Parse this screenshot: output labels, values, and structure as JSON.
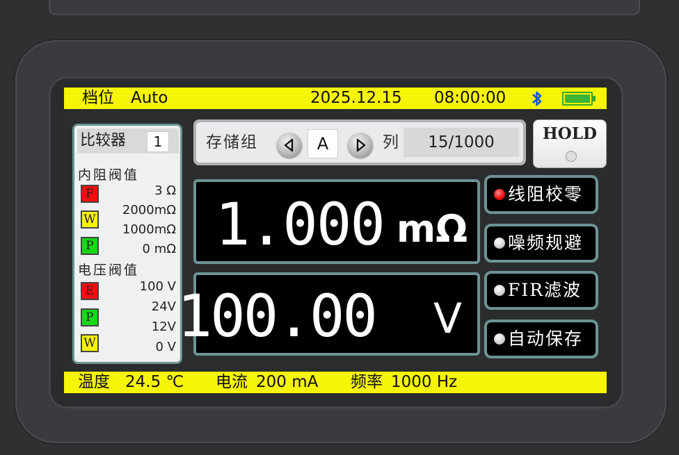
{
  "status": {
    "range_label": "档位",
    "range_value": "Auto",
    "date": "2025.12.15",
    "time": "08:00:00",
    "bluetooth_icon": "bluetooth-icon",
    "battery_icon": "battery-full-icon",
    "battery_level": 1.0
  },
  "comparator": {
    "label": "比较器",
    "value": "1"
  },
  "resistance_threshold": {
    "title": "内阻阀值",
    "levels": [
      {
        "badge": "F",
        "color": "#f20f0f",
        "value": "3 Ω"
      },
      {
        "badge": "W",
        "color": "#f6f407",
        "value": "2000mΩ"
      },
      {
        "badge": "P",
        "color": "#14d914",
        "value": "1000mΩ"
      },
      {
        "badge": "",
        "value": "0 mΩ"
      }
    ]
  },
  "voltage_threshold": {
    "title": "电压阀值",
    "levels": [
      {
        "badge": "E",
        "color": "#f20f0f",
        "value": "100 V"
      },
      {
        "badge": "P",
        "color": "#14d914",
        "value": "24V"
      },
      {
        "badge": "W",
        "color": "#f6f407",
        "value": "12V"
      },
      {
        "badge": "",
        "value": "0 V"
      }
    ]
  },
  "storage": {
    "label": "存储组",
    "group": "A",
    "column_label": "列",
    "count": "15/1000"
  },
  "hold": {
    "label": "HOLD"
  },
  "resistance": {
    "value": "1.000",
    "unit": "mΩ"
  },
  "voltage": {
    "value": "100.00",
    "unit": "V"
  },
  "functions": [
    {
      "label": "线阻校零",
      "active": true
    },
    {
      "label": "噪频规避",
      "active": false
    },
    {
      "label": "FIR滤波",
      "active": false
    },
    {
      "label": "自动保存",
      "active": false
    }
  ],
  "bottom": {
    "temp_label": "温度",
    "temp_value": "24.5 ℃",
    "current_label": "电流",
    "current_value": "200 mA",
    "freq_label": "频率",
    "freq_value": "1000 Hz"
  }
}
